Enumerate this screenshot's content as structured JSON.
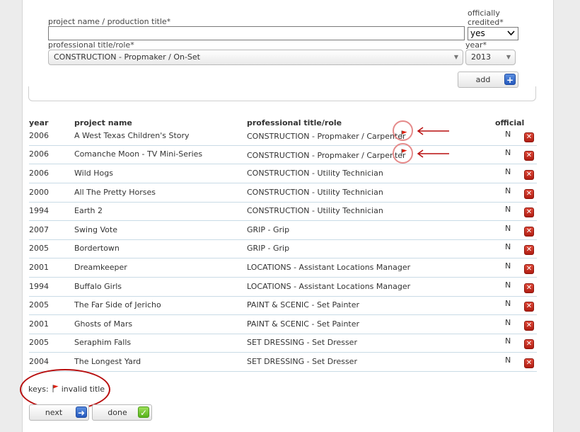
{
  "form": {
    "project_label": "project name / production title*",
    "project_value": "",
    "credited_label_1": "officially",
    "credited_label_2": "credited*",
    "credited_value": "yes",
    "role_label": "professional title/role*",
    "role_value": "CONSTRUCTION - Propmaker / On-Set",
    "year_label": "year*",
    "year_value": "2013",
    "add_label": "add"
  },
  "table": {
    "headers": {
      "year": "year",
      "project": "project name",
      "role": "professional title/role",
      "official": "official"
    },
    "rows": [
      {
        "year": "2006",
        "project": "A West Texas Children's Story",
        "role": "CONSTRUCTION - Propmaker / Carpenter",
        "official": "N",
        "invalid": true
      },
      {
        "year": "2006",
        "project": "Comanche Moon - TV Mini-Series",
        "role": "CONSTRUCTION - Propmaker / Carpenter",
        "official": "N",
        "invalid": true
      },
      {
        "year": "2006",
        "project": "Wild Hogs",
        "role": "CONSTRUCTION - Utility Technician",
        "official": "N",
        "invalid": false
      },
      {
        "year": "2000",
        "project": "All The Pretty Horses",
        "role": "CONSTRUCTION - Utility Technician",
        "official": "N",
        "invalid": false
      },
      {
        "year": "1994",
        "project": "Earth 2",
        "role": "CONSTRUCTION - Utility Technician",
        "official": "N",
        "invalid": false
      },
      {
        "year": "2007",
        "project": "Swing Vote",
        "role": "GRIP - Grip",
        "official": "N",
        "invalid": false
      },
      {
        "year": "2005",
        "project": "Bordertown",
        "role": "GRIP - Grip",
        "official": "N",
        "invalid": false
      },
      {
        "year": "2001",
        "project": "Dreamkeeper",
        "role": "LOCATIONS - Assistant Locations Manager",
        "official": "N",
        "invalid": false
      },
      {
        "year": "1994",
        "project": "Buffalo Girls",
        "role": "LOCATIONS - Assistant Locations Manager",
        "official": "N",
        "invalid": false
      },
      {
        "year": "2005",
        "project": "The Far Side of Jericho",
        "role": "PAINT & SCENIC - Set Painter",
        "official": "N",
        "invalid": false
      },
      {
        "year": "2001",
        "project": "Ghosts of Mars",
        "role": "PAINT & SCENIC - Set Painter",
        "official": "N",
        "invalid": false
      },
      {
        "year": "2005",
        "project": "Seraphim Falls",
        "role": "SET DRESSING - Set Dresser",
        "official": "N",
        "invalid": false
      },
      {
        "year": "2004",
        "project": "The Longest Yard",
        "role": "SET DRESSING - Set Dresser",
        "official": "N",
        "invalid": false
      }
    ]
  },
  "keys": {
    "label": "keys:",
    "invalid_text": "invalid title"
  },
  "buttons": {
    "next_label": "next",
    "done_label": "done"
  },
  "colors": {
    "accent_blue": "#2559bd",
    "delete_red": "#c0281b",
    "annotation_red": "#b80e0e",
    "done_green": "#57b21c"
  }
}
